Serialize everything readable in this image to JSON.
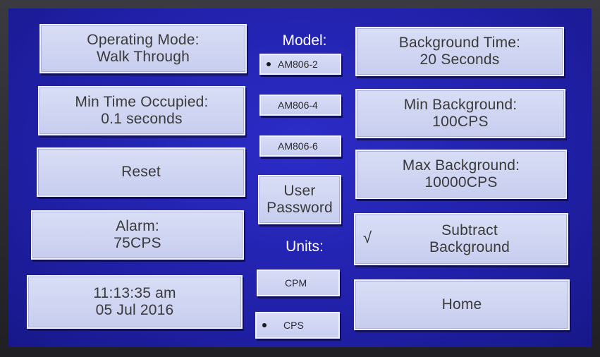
{
  "left": {
    "operating_mode": {
      "line1": "Operating Mode:",
      "line2": "Walk Through"
    },
    "min_time": {
      "line1": "Min Time Occupied:",
      "line2": "0.1 seconds"
    },
    "reset": {
      "label": "Reset"
    },
    "alarm": {
      "line1": "Alarm:",
      "line2": "75CPS"
    },
    "clock": {
      "time": "11:13:35 am",
      "date": "05 Jul 2016"
    }
  },
  "center": {
    "model_label": "Model:",
    "models": [
      {
        "label": "AM806-2",
        "selected": true
      },
      {
        "label": "AM806-4",
        "selected": false
      },
      {
        "label": "AM806-6",
        "selected": false
      }
    ],
    "user_password": {
      "line1": "User",
      "line2": "Password"
    },
    "units_label": "Units:",
    "units": [
      {
        "label": "CPM",
        "selected": false
      },
      {
        "label": "CPS",
        "selected": true
      }
    ]
  },
  "right": {
    "background_time": {
      "line1": "Background Time:",
      "line2": "20 Seconds"
    },
    "min_background": {
      "line1": "Min Background:",
      "line2": "100CPS"
    },
    "max_background": {
      "line1": "Max Background:",
      "line2": "10000CPS"
    },
    "subtract_background": {
      "line1": "Subtract",
      "line2": "Background",
      "checked": true,
      "check_glyph": "√"
    },
    "home": {
      "label": "Home"
    }
  }
}
